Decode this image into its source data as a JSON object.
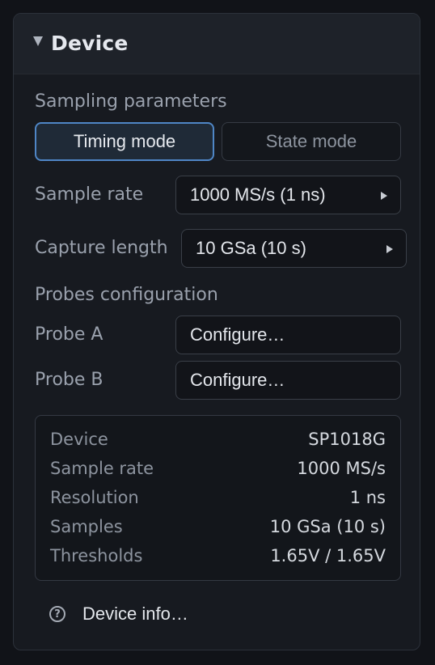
{
  "header": {
    "title": "Device",
    "caret_icon": "caret-down-icon"
  },
  "sampling": {
    "section_label": "Sampling parameters",
    "modes": [
      {
        "label": "Timing mode",
        "active": true
      },
      {
        "label": "State mode",
        "active": false
      }
    ],
    "sample_rate_label": "Sample rate",
    "sample_rate_value": "1000 MS/s (1 ns)",
    "capture_length_label": "Capture length",
    "capture_length_value": "10 GSa (10 s)"
  },
  "probes": {
    "section_label": "Probes configuration",
    "items": [
      {
        "label": "Probe A",
        "button": "Configure…"
      },
      {
        "label": "Probe B",
        "button": "Configure…"
      }
    ]
  },
  "summary": [
    {
      "key": "Device",
      "value": "SP1018G"
    },
    {
      "key": "Sample rate",
      "value": "1000 MS/s"
    },
    {
      "key": "Resolution",
      "value": "1 ns"
    },
    {
      "key": "Samples",
      "value": "10 GSa (10 s)"
    },
    {
      "key": "Thresholds",
      "value": "1.65V / 1.65V"
    }
  ],
  "device_info": {
    "label": "Device info…",
    "icon": "help-circle-icon"
  },
  "colors": {
    "accent": "#4f86c6",
    "panel_bg": "#171a20",
    "header_bg": "#1e2229",
    "text_primary": "#e4e7ec",
    "text_secondary": "#9aa1ad"
  }
}
